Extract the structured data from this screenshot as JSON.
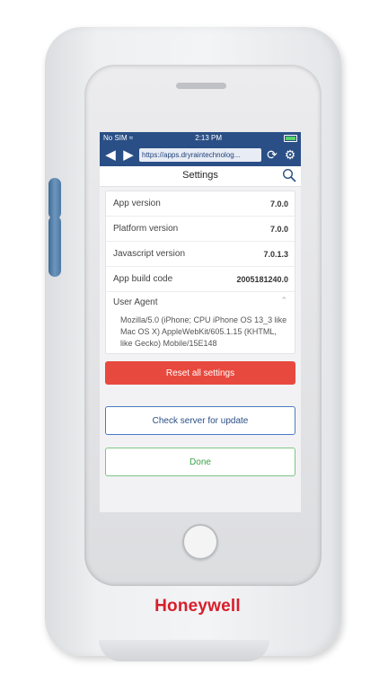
{
  "status_bar": {
    "carrier": "No SIM",
    "time": "2:13 PM"
  },
  "browser": {
    "url": "https://apps.dryraintechnolog..."
  },
  "settings": {
    "title": "Settings",
    "rows": [
      {
        "label": "App version",
        "value": "7.0.0"
      },
      {
        "label": "Platform version",
        "value": "7.0.0"
      },
      {
        "label": "Javascript version",
        "value": "7.0.1.3"
      },
      {
        "label": "App build code",
        "value": "2005181240.0"
      }
    ],
    "user_agent": {
      "label": "User Agent",
      "value": "Mozilla/5.0 (iPhone; CPU iPhone OS 13_3 like Mac OS X) AppleWebKit/605.1.15 (KHTML, like Gecko) Mobile/15E148"
    }
  },
  "buttons": {
    "reset": "Reset all settings",
    "check_update": "Check server for update",
    "done": "Done"
  },
  "brand": "Honeywell",
  "colors": {
    "header_blue": "#2a4f86",
    "reset_red": "#e8493e",
    "done_green": "#3aa346",
    "brand_red": "#d81e2a"
  }
}
